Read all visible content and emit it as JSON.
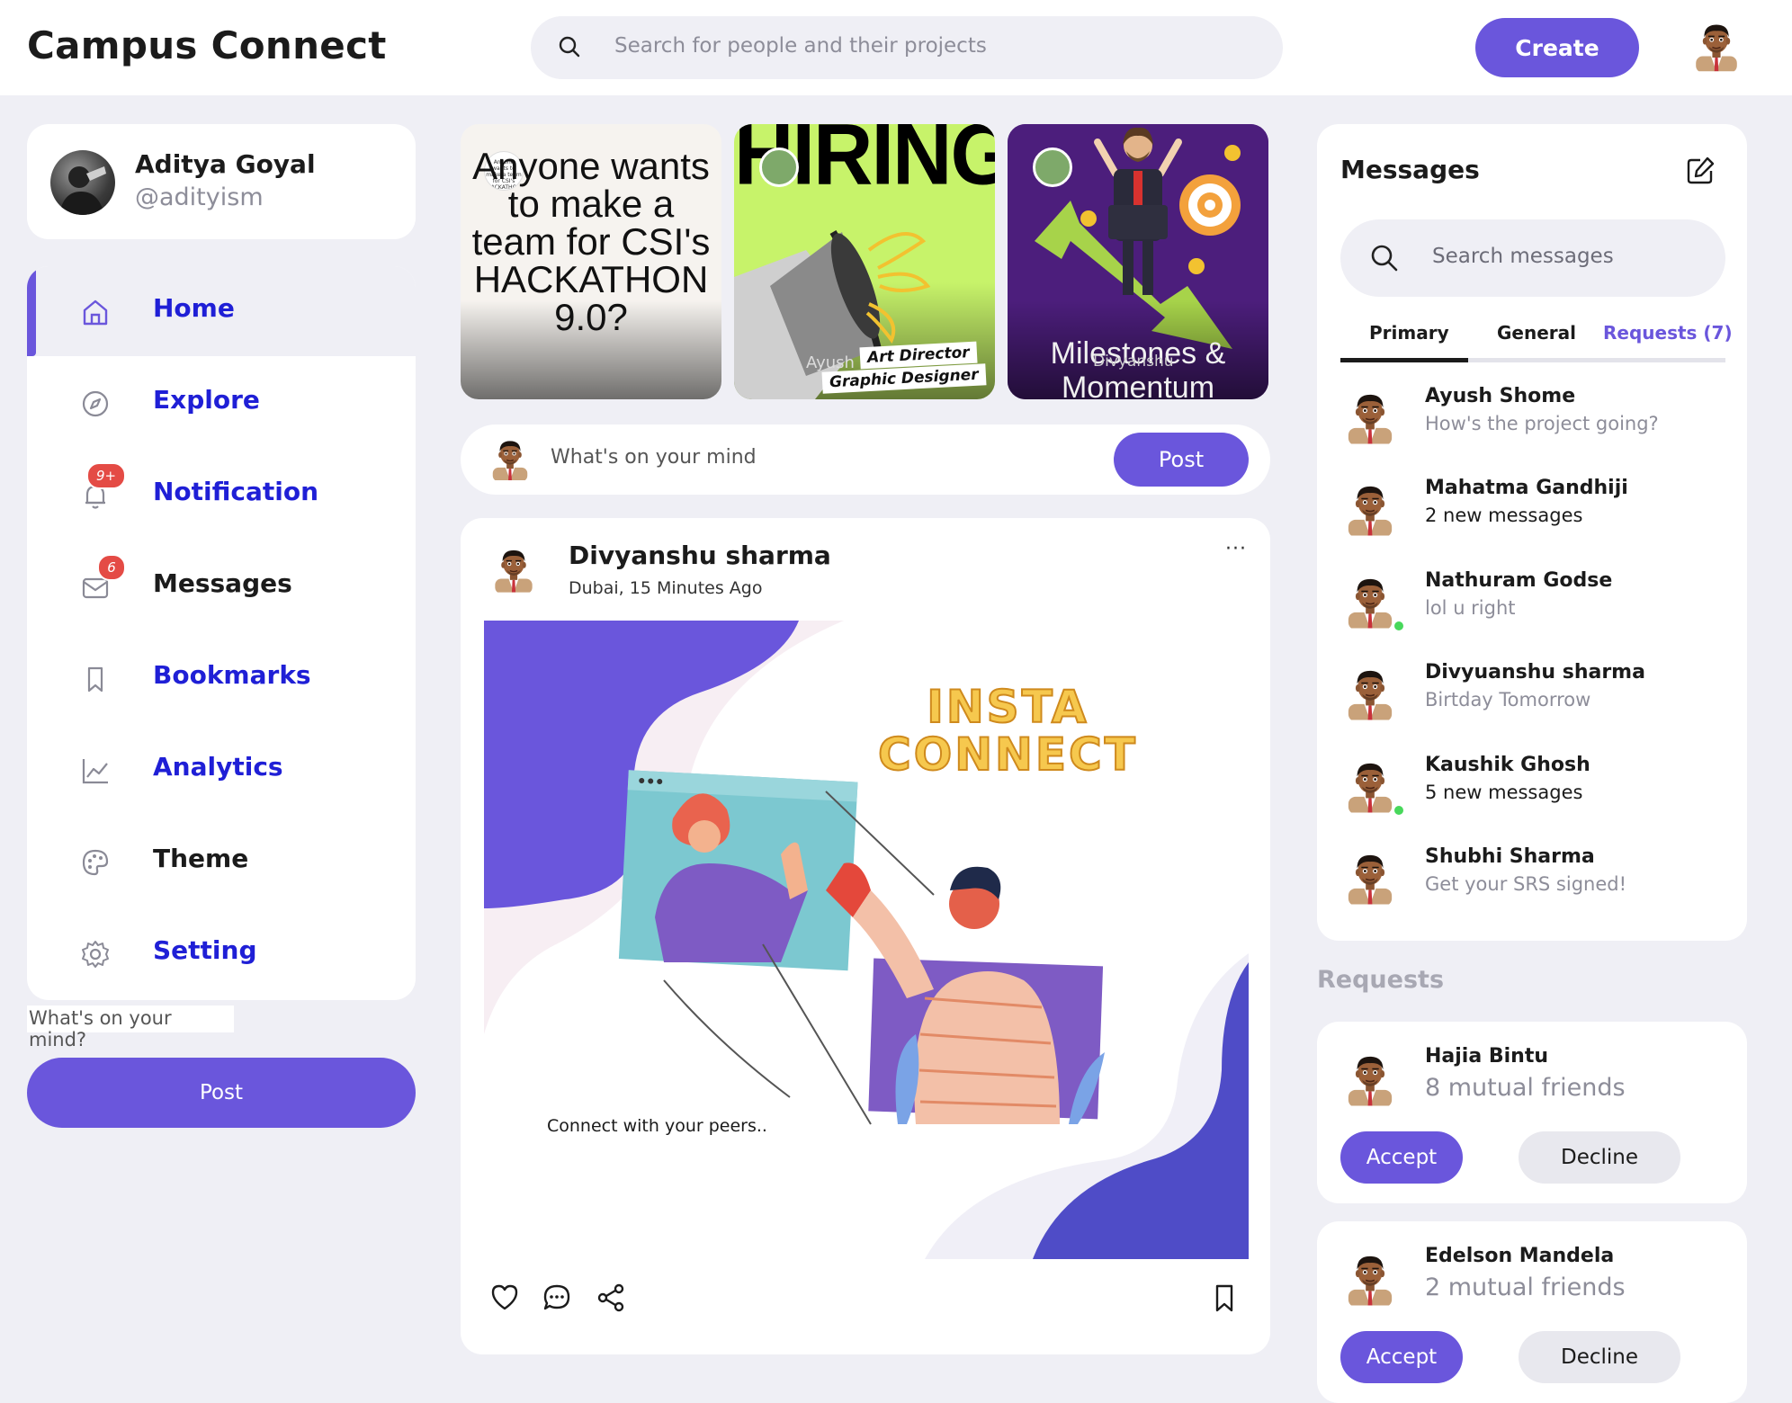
{
  "app": {
    "title": "Campus Connect"
  },
  "header": {
    "search_placeholder": "Search for people and their projects",
    "create_label": "Create"
  },
  "profile": {
    "name": "Aditya Goyal",
    "handle": "@adityism"
  },
  "nav": {
    "items": [
      {
        "label": "Home",
        "icon": "home-icon",
        "color": "#1f1fd6"
      },
      {
        "label": "Explore",
        "icon": "compass-icon",
        "color": "#1f1fd6"
      },
      {
        "label": "Notification",
        "icon": "bell-icon",
        "color": "#1f1fd6",
        "badge": "9+"
      },
      {
        "label": "Messages",
        "icon": "mail-icon",
        "color": "#1b1b1b",
        "badge": "6"
      },
      {
        "label": "Bookmarks",
        "icon": "bookmark-icon",
        "color": "#1f1fd6"
      },
      {
        "label": "Analytics",
        "icon": "chart-icon",
        "color": "#1f1fd6"
      },
      {
        "label": "Theme",
        "icon": "palette-icon",
        "color": "#1b1b1b"
      },
      {
        "label": "Setting",
        "icon": "gear-icon",
        "color": "#1f1fd6"
      }
    ]
  },
  "left_composer": {
    "label": "What's on your mind?",
    "post_label": "Post"
  },
  "stories": [
    {
      "text": "Anyone wants to make a team for CSI's HACKATHON 9.0?",
      "small_text": "Anyone wants to make a team for CSI's HACKATHON 9.0?"
    },
    {
      "headline": "HIRING",
      "line1": "Art Director",
      "line2": "Graphic Designer",
      "overlay_name": "Ayush"
    },
    {
      "title": "Milestones & Momentum",
      "overlay_name": "Divyanshu"
    }
  ],
  "composer": {
    "placeholder": "What's on your mind",
    "post_label": "Post"
  },
  "post": {
    "author": "Divyanshu sharma",
    "meta": "Dubai, 15 Minutes Ago",
    "more": "···",
    "image_title_1": "INSTA",
    "image_title_2": "CONNECT",
    "caption": "Connect with your peers.."
  },
  "messages": {
    "title": "Messages",
    "search_placeholder": "Search messages",
    "tabs": [
      "Primary",
      "General",
      "Requests (7)"
    ],
    "rows": [
      {
        "name": "Ayush Shome",
        "text": "How's the project going?",
        "unread": false,
        "online": false
      },
      {
        "name": "Mahatma Gandhiji",
        "text": "2 new messages",
        "unread": true,
        "online": false
      },
      {
        "name": "Nathuram Godse",
        "text": "lol u right",
        "unread": false,
        "online": true
      },
      {
        "name": "Divyuanshu sharma",
        "text": "Birtday Tomorrow",
        "unread": false,
        "online": false
      },
      {
        "name": "Kaushik Ghosh",
        "text": "5 new messages",
        "unread": true,
        "online": true
      },
      {
        "name": "Shubhi Sharma",
        "text": "Get your SRS signed!",
        "unread": false,
        "online": false
      }
    ]
  },
  "requests": {
    "title": "Requests",
    "items": [
      {
        "name": "Hajia Bintu",
        "mutual": "8 mutual friends",
        "accept": "Accept",
        "decline": "Decline"
      },
      {
        "name": "Edelson Mandela",
        "mutual": "2 mutual friends",
        "accept": "Accept",
        "decline": "Decline"
      }
    ]
  },
  "colors": {
    "accent": "#6a56dc",
    "nav_link": "#1f1fd6",
    "badge": "#e44b45",
    "online": "#48d85b"
  }
}
